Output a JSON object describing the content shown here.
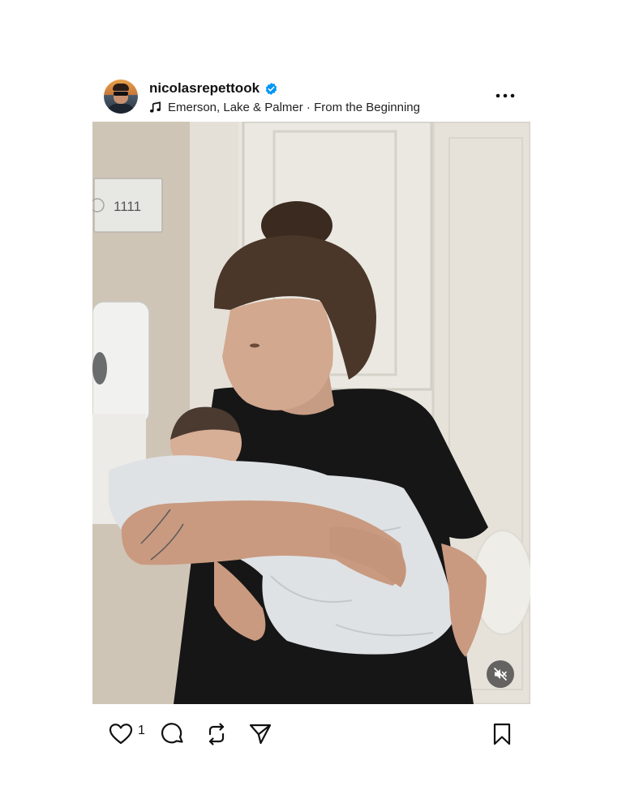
{
  "post": {
    "username": "nicolasrepettook",
    "verified": true,
    "audio": "Emerson, Lake & Palmer · From the Beginning",
    "media": {
      "door_sign_text": "1111",
      "sound": "muted"
    },
    "actions": {
      "like_count": "1"
    }
  },
  "icons": {
    "verified": "verified-badge-icon",
    "music": "music-note-icon",
    "more": "more-options-icon",
    "mute": "speaker-muted-icon",
    "like": "heart-icon",
    "comment": "comment-icon",
    "repost": "repost-icon",
    "share": "share-icon",
    "save": "bookmark-icon"
  },
  "colors": {
    "verified_blue": "#0095f6",
    "text": "#111111",
    "background": "#ffffff"
  }
}
